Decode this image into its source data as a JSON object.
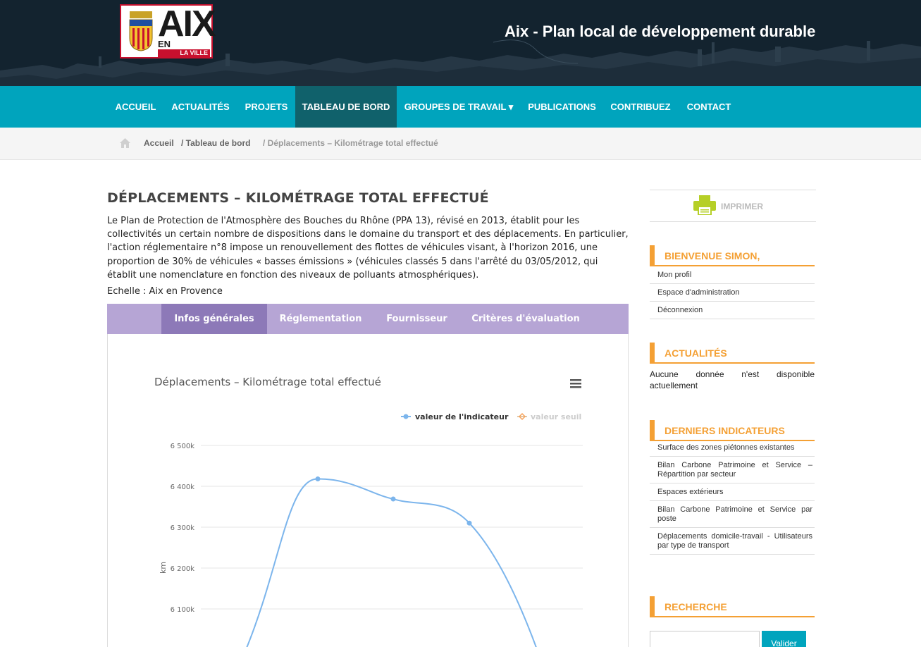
{
  "header": {
    "logo_text": "AIX",
    "logo_sub": "EN PROVENCE",
    "logo_tag": "LA VILLE",
    "site_title": "Aix - Plan local de développement durable"
  },
  "nav": {
    "items": [
      {
        "label": "ACCUEIL"
      },
      {
        "label": "ACTUALITÉS"
      },
      {
        "label": "PROJETS"
      },
      {
        "label": "TABLEAU DE BORD",
        "active": true
      },
      {
        "label": "GROUPES DE TRAVAIL ▾"
      },
      {
        "label": "PUBLICATIONS"
      },
      {
        "label": "CONTRIBUEZ"
      },
      {
        "label": "CONTACT"
      }
    ]
  },
  "breadcrumb": {
    "home": "Accueil",
    "level1": "/ Tableau de bord",
    "current": "/ Déplacements – Kilométrage total effectué"
  },
  "main": {
    "title": "DÉPLACEMENTS – KILOMÉTRAGE TOTAL EFFECTUÉ",
    "intro": "Le Plan de Protection de l'Atmosphère des Bouches du Rhône (PPA 13), révisé en 2013, établit pour les collectivités un certain nombre de dispositions dans le domaine du transport et des déplacements. En particulier, l'action réglementaire n°8 impose un renouvellement des flottes de véhicules visant, à l'horizon 2016, une proportion de 30% de véhicules « basses émissions » (véhicules classés 5 dans l'arrêté du 03/05/2012, qui établit une nomenclature en fonction des niveaux de polluants atmosphériques).",
    "scale": "Echelle : Aix en Provence",
    "tabs": [
      {
        "label": "Infos générales",
        "active": true
      },
      {
        "label": "Réglementation"
      },
      {
        "label": "Fournisseur"
      },
      {
        "label": "Critères d'évaluation"
      }
    ]
  },
  "chart_data": {
    "type": "line",
    "title": "Déplacements – Kilométrage total effectué",
    "ylabel": "km",
    "ylim": [
      6100,
      6500
    ],
    "y_ticks": [
      {
        "value": 6500,
        "label": "6 500k"
      },
      {
        "value": 6400,
        "label": "6 400k"
      },
      {
        "value": 6300,
        "label": "6 300k"
      },
      {
        "value": 6200,
        "label": "6 200k"
      },
      {
        "value": 6100,
        "label": "6 100k"
      }
    ],
    "legend_position": "top-right",
    "grid": true,
    "series": [
      {
        "name": "valeur de l'indicateur",
        "color": "#7cb5ec",
        "values": [
          6418,
          6369,
          6310
        ],
        "visible": true
      },
      {
        "name": "valeur seuil",
        "color": "#f7a35c",
        "values": [],
        "visible": false
      }
    ]
  },
  "sidebar": {
    "print_label": "IMPRIMER",
    "welcome": {
      "title": "BIENVENUE SIMON,",
      "links": [
        "Mon profil",
        "Espace d'administration",
        "Déconnexion"
      ]
    },
    "news": {
      "title": "ACTUALITÉS",
      "text": "Aucune donnée n'est disponible actuellement"
    },
    "indicators": {
      "title": "DERNIERS INDICATEURS",
      "links": [
        "Surface des zones piétonnes existantes",
        "Bilan Carbone Patrimoine et Service – Répartition par secteur",
        "Espaces extérieurs",
        "Bilan Carbone Patrimoine et Service par poste",
        "Déplacements domicile-travail - Utilisateurs par type de transport"
      ]
    },
    "search": {
      "title": "RECHERCHE",
      "button": "Valider",
      "value": ""
    }
  },
  "colors": {
    "header_bg": "#13232f",
    "nav_bg": "#00a4bd",
    "nav_active": "#10616b",
    "tabs_bg": "#b6a5d5",
    "tab_active": "#8d79b8",
    "accent_orange": "#f4a034",
    "print_green": "#b6cf26"
  }
}
